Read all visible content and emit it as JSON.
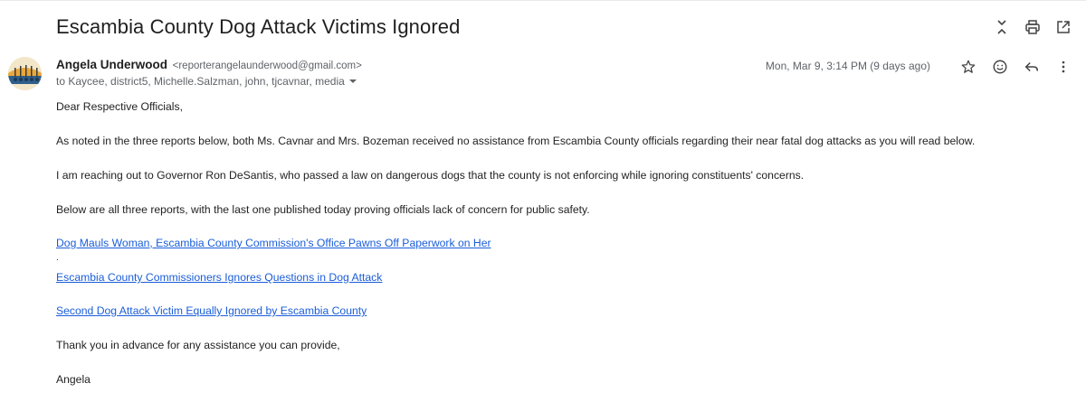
{
  "email": {
    "subject": "Escambia County Dog Attack Victims Ignored",
    "sender_name": "Angela Underwood",
    "sender_email": "<reporterangelaunderwood@gmail.com>",
    "recipients": "to Kaycee, district5, Michelle.Salzman, john, tjcavnar, media",
    "date": "Mon, Mar 9, 3:14 PM (9 days ago)",
    "body": {
      "greeting": "Dear Respective Officials,",
      "p1": "As noted in the three reports below, both Ms. Cavnar and Mrs. Bozeman received no assistance from Escambia County officials regarding their near fatal dog attacks as you will read below.",
      "p2": "I am reaching out to Governor Ron DeSantis, who passed a law on dangerous dogs that the county is not enforcing while ignoring constituents' concerns.",
      "p3": "Below are all three reports, with the last one published today proving officials lack of concern for public safety.",
      "links": [
        "Dog Mauls Woman, Escambia County Commission's Office Pawns Off Paperwork on Her",
        "Escambia County Commissioners Ignores Questions in Dog Attack",
        "Second Dog Attack Victim Equally Ignored by Escambia County"
      ],
      "separator": ".",
      "closing": "Thank you in advance for any assistance you can provide,",
      "signature": "Angela"
    }
  },
  "icons": {
    "collapse": "collapse-all-icon",
    "print": "print-icon",
    "popout": "open-in-new-window-icon",
    "star": "star-icon",
    "emoji": "emoji-react-icon",
    "reply": "reply-icon",
    "more": "more-vert-icon"
  },
  "colors": {
    "link": "#1a5dd9",
    "secondary_text": "#5f6368"
  }
}
